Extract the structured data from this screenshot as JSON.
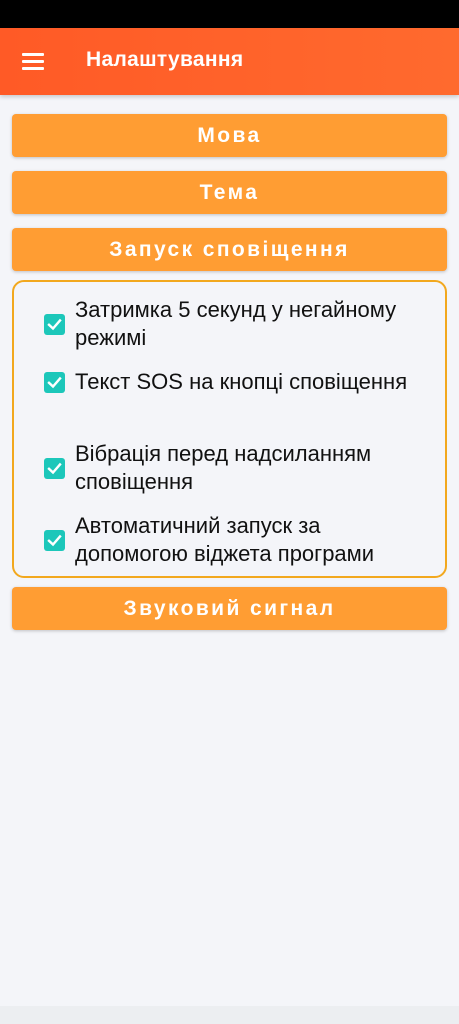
{
  "app_bar": {
    "title": "Налаштування",
    "menu_icon": "hamburger-menu-icon"
  },
  "sections": {
    "language": "Мова",
    "theme": "Тема",
    "alert_launch": "Запуск сповіщення",
    "sound_signal": "Звуковий сигнал"
  },
  "options": [
    {
      "label": "Затримка 5 секунд у негайному режимі",
      "checked": true
    },
    {
      "label": "Текст SOS на кнопці сповіщення",
      "checked": true
    },
    {
      "label": "Вібрація перед надсиланням сповіщення",
      "checked": true
    },
    {
      "label": "Автоматичний запуск за допомогою віджета програми",
      "checked": true
    }
  ],
  "colors": {
    "app_bar": "#ff5a26",
    "section_button": "#ff9d33",
    "panel_border": "#f2a81e",
    "checkbox": "#1cc7ba",
    "background": "#f4f5f9"
  }
}
